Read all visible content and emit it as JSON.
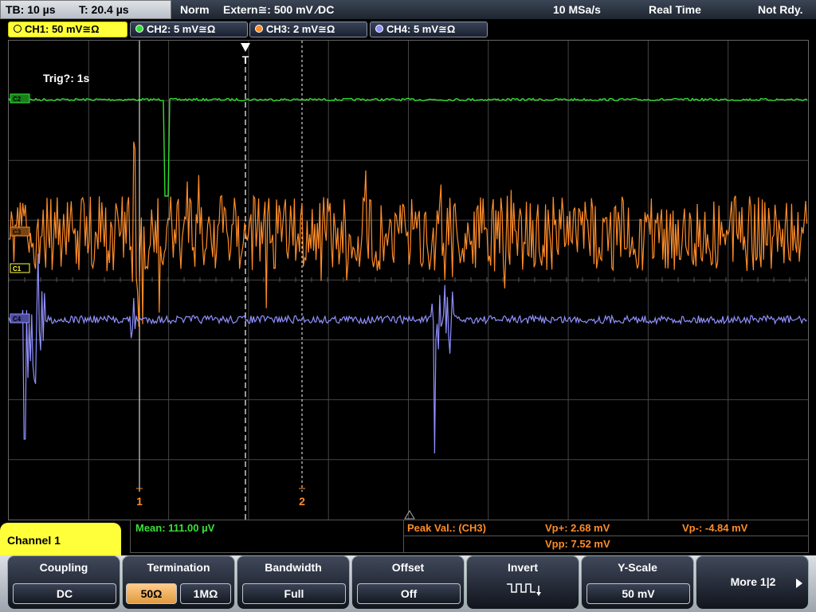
{
  "status_bar": {
    "timebase": "TB: 10 µs",
    "trigger_time": "T: 20.4 µs",
    "trigger_mode": "Norm",
    "trigger_source": "Extern≅: 500 mV ⁄DC",
    "sample_rate": "10 MSa/s",
    "acq_mode": "Real Time",
    "state": "Not Rdy."
  },
  "channel_tabs": [
    {
      "label": "CH1: 50 mV≅Ω",
      "color": "#ffff3a",
      "active": true
    },
    {
      "label": "CH2: 5 mV≅Ω",
      "color": "#2fe02f",
      "active": false
    },
    {
      "label": "CH3: 2 mV≅Ω",
      "color": "#ff8c28",
      "active": false
    },
    {
      "label": "CH4: 5 mV≅Ω",
      "color": "#9090ff",
      "active": false
    }
  ],
  "screen": {
    "trig_label": "Trig?: 1s",
    "trigger_marker": "T",
    "cursor1_label": "1",
    "cursor2_label": "2",
    "ch_markers": {
      "ch2": "C2",
      "ch3": "C3",
      "ch1": "C1",
      "ch4": "C4"
    }
  },
  "measurements": {
    "mean": "Mean: 111.00 µV",
    "peak_label": "Peak Val.:  (CH3)",
    "vp_plus": "Vp+: 2.68 mV",
    "vp_minus": "Vp-: -4.84 mV",
    "vpp": "Vpp: 7.52 mV"
  },
  "channel_panel": {
    "title": "Channel 1"
  },
  "softkeys": {
    "coupling": {
      "title": "Coupling",
      "value": "DC"
    },
    "termination": {
      "title": "Termination",
      "opt1": "50Ω",
      "opt2": "1MΩ"
    },
    "bandwidth": {
      "title": "Bandwidth",
      "value": "Full"
    },
    "offset": {
      "title": "Offset",
      "value": "Off"
    },
    "invert": {
      "title": "Invert"
    },
    "yscale": {
      "title": "Y-Scale",
      "value": "50 mV"
    },
    "more": {
      "label": "More 1|2"
    }
  },
  "colors": {
    "ch1": "#ffff3a",
    "ch2": "#2fe02f",
    "ch3": "#ff8c28",
    "ch4": "#9090ff",
    "measure_green": "#38e038",
    "measure_orange": "#ff8c28"
  }
}
